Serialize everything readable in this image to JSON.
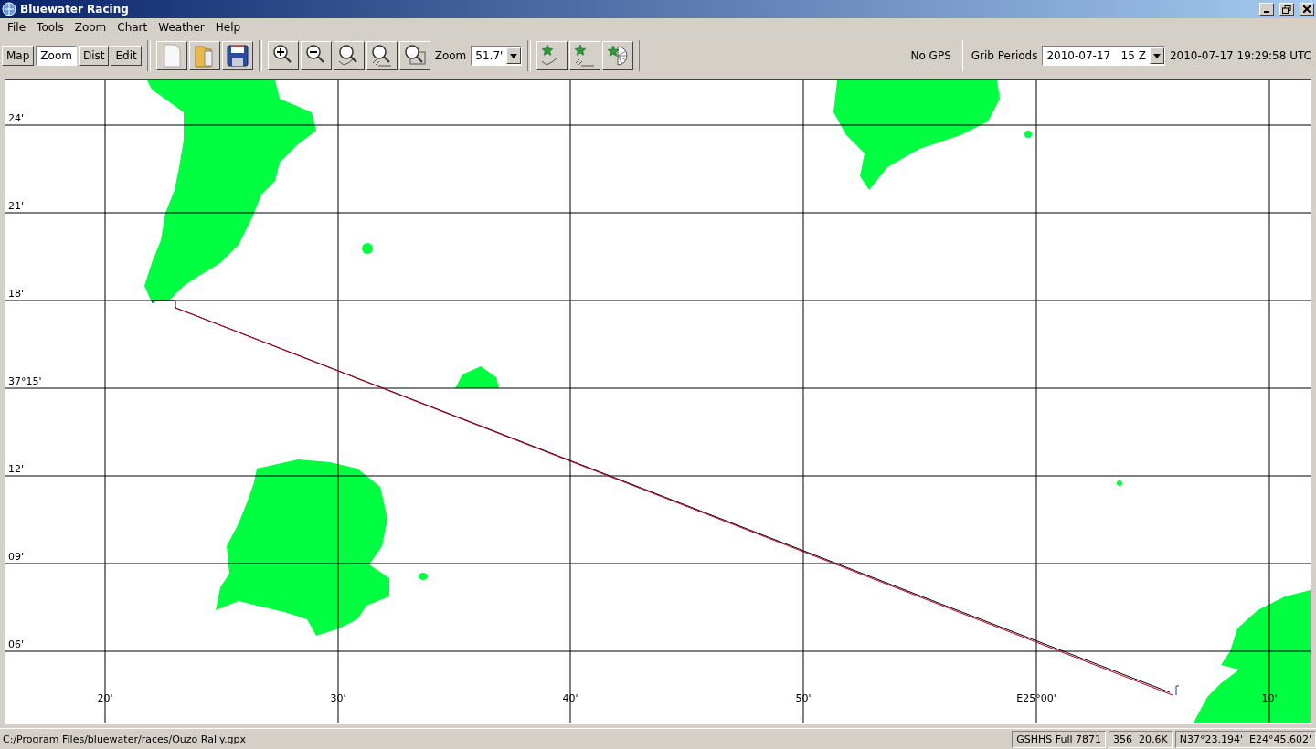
{
  "window": {
    "title": "Bluewater Racing"
  },
  "menu": [
    "File",
    "Tools",
    "Zoom",
    "Chart",
    "Weather",
    "Help"
  ],
  "modes": [
    {
      "label": "Map",
      "selected": false
    },
    {
      "label": "Zoom",
      "selected": true
    },
    {
      "label": "Dist",
      "selected": false
    },
    {
      "label": "Edit",
      "selected": false
    }
  ],
  "zoom": {
    "label": "Zoom",
    "value": "51.7'"
  },
  "gps_status": "No GPS",
  "grib": {
    "label": "Grib Periods",
    "value": "2010-07-17   15 Z"
  },
  "time": "2010-07-17 19:29:58 UTC",
  "map": {
    "lat_labels": [
      "24'",
      "21'",
      "18'",
      "37°15'",
      "12'",
      "09'",
      "06'"
    ],
    "lon_labels": [
      "20'",
      "30'",
      "40'",
      "50'",
      "E25°00'",
      "10'"
    ]
  },
  "status_bar": {
    "path": "C:/Program Files/bluewater/races/Ouzo Rally.gpx",
    "sections": [
      "GSHHS Full 7871",
      "356  20.6K",
      "N37°23.194'  E24°45.602'"
    ]
  }
}
